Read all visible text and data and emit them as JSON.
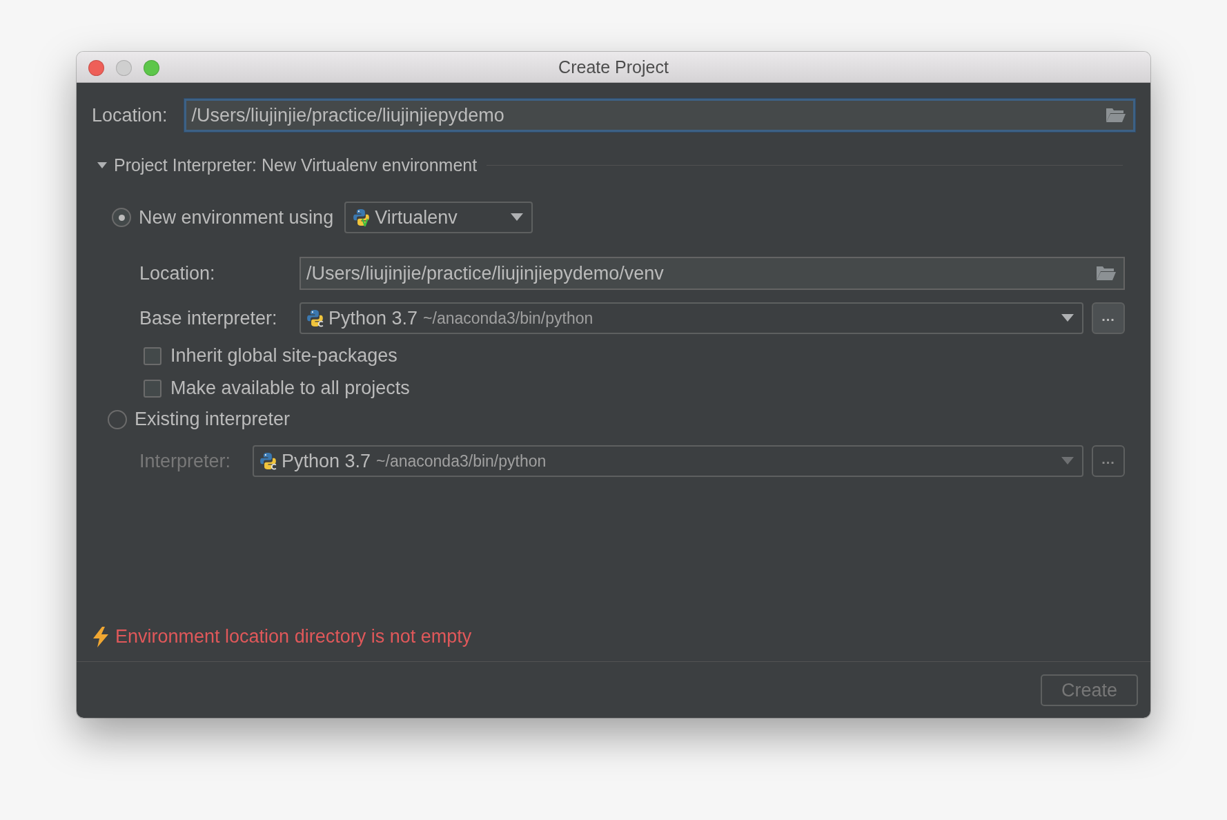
{
  "window": {
    "title": "Create Project"
  },
  "location": {
    "label": "Location:",
    "value": "/Users/liujinjie/practice/liujinjiepydemo"
  },
  "interpreter_section": {
    "title": "Project Interpreter: New Virtualenv environment",
    "expanded": true
  },
  "new_environment": {
    "label": "New environment using",
    "selected": true,
    "tool": "Virtualenv",
    "location": {
      "label": "Location:",
      "value": "/Users/liujinjie/practice/liujinjiepydemo/venv"
    },
    "base_interpreter": {
      "label": "Base interpreter:",
      "name": "Python 3.7",
      "path": "~/anaconda3/bin/python",
      "browse": "..."
    },
    "checkboxes": [
      {
        "label": "Inherit global site-packages",
        "checked": false
      },
      {
        "label": "Make available to all projects",
        "checked": false
      }
    ]
  },
  "existing_interpreter": {
    "label": "Existing interpreter",
    "selected": false,
    "interpreter": {
      "label": "Interpreter:",
      "name": "Python 3.7",
      "path": "~/anaconda3/bin/python",
      "browse": "...",
      "disabled": true
    }
  },
  "error": {
    "text": "Environment location directory is not empty"
  },
  "buttons": [
    {
      "label": "Create",
      "disabled": true
    }
  ]
}
